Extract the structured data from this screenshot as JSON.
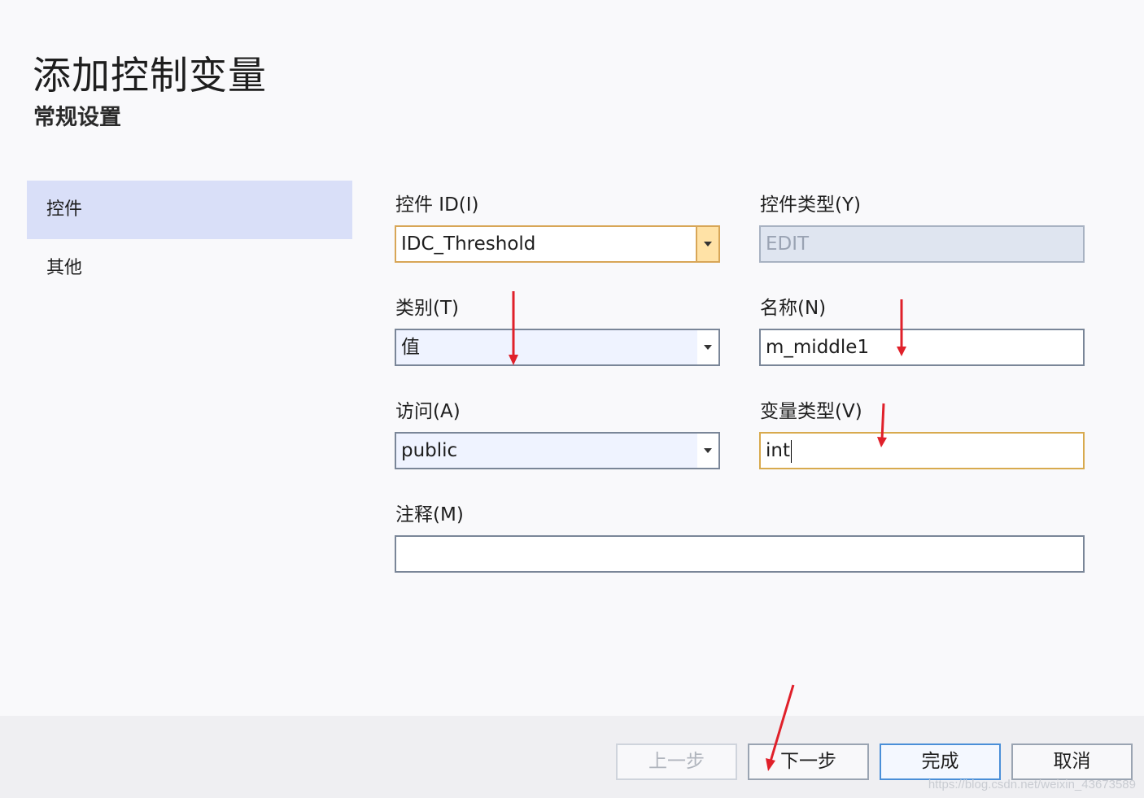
{
  "header": {
    "title": "添加控制变量",
    "subtitle": "常规设置"
  },
  "sidebar": {
    "items": [
      {
        "label": "控件",
        "selected": true
      },
      {
        "label": "其他",
        "selected": false
      }
    ]
  },
  "form": {
    "control_id": {
      "label": "控件 ID(I)",
      "value": "IDC_Threshold"
    },
    "control_type": {
      "label": "控件类型(Y)",
      "value": "EDIT"
    },
    "category": {
      "label": "类别(T)",
      "value": "值"
    },
    "name": {
      "label": "名称(N)",
      "value": "m_middle1"
    },
    "access": {
      "label": "访问(A)",
      "value": "public"
    },
    "variable_type": {
      "label": "变量类型(V)",
      "value": "int"
    },
    "comment": {
      "label": "注释(M)",
      "value": ""
    }
  },
  "footer": {
    "prev_label": "上一步",
    "next_label": "下一步",
    "finish_label": "完成",
    "cancel_label": "取消"
  },
  "watermark": "https://blog.csdn.net/weixin_43673589",
  "colors": {
    "annotation_arrow": "#e0202a",
    "selected_nav": "#d9dff8",
    "focus_border": "#d8aa4e"
  }
}
